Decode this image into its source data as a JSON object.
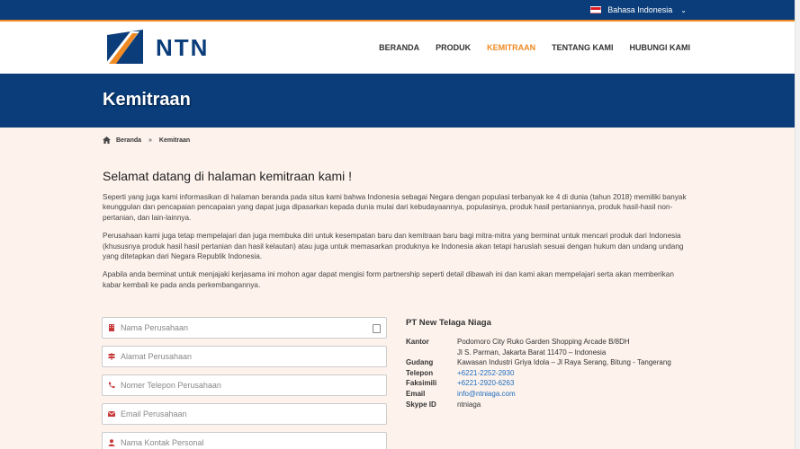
{
  "topbar": {
    "language": "Bahasa Indonesia",
    "flag_icon": "indonesia-flag-icon",
    "chevron_icon": "chevron-down-icon"
  },
  "header": {
    "logo_text": "NTN",
    "nav": [
      {
        "label": "BERANDA",
        "active": false
      },
      {
        "label": "PRODUK",
        "active": false
      },
      {
        "label": "KEMITRAAN",
        "active": true
      },
      {
        "label": "TENTANG KAMI",
        "active": false
      },
      {
        "label": "HUBUNGI KAMI",
        "active": false
      }
    ],
    "accent_color": "#f08a24",
    "brand_color": "#0a3d7a"
  },
  "banner": {
    "title": "Kemitraan"
  },
  "breadcrumb": {
    "home": "Beranda",
    "separator": "»",
    "current": "Kemitraan"
  },
  "main": {
    "heading": "Selamat datang di halaman kemitraan kami !",
    "paragraphs": [
      "Seperti yang juga kami informasikan di halaman beranda pada situs kami bahwa Indonesia sebagai Negara dengan populasi terbanyak ke 4 di dunia (tahun 2018) memiliki banyak keunggulan dan pencapaian pencapaian yang dapat juga dipasarkan kepada dunia mulai dari kebudayaannya, populasinya, produk hasil pertaniannya, produk hasil-hasil non-pertanian, dan lain-lainnya.",
      "Perusahaan kami juga tetap mempelajari dan juga membuka diri untuk kesempatan baru dan kemitraan baru bagi mitra-mitra yang berminat untuk mencari produk dari Indonesia (khususnya produk hasil hasil pertanian dan hasil kelautan) atau juga untuk memasarkan produknya ke Indonesia akan tetapi haruslah sesuai dengan hukum dan undang undang yang ditetapkan dari Negara Republik Indonesia.",
      "Apabila anda berminat untuk menjajaki kerjasama ini mohon agar dapat mengisi form partnership seperti detail dibawah ini dan kami akan mempelajari serta akan memberikan kabar kembali ke pada anda perkembangannya."
    ]
  },
  "form": {
    "fields": [
      {
        "placeholder": "Nama Perusahaan",
        "icon": "building-icon"
      },
      {
        "placeholder": "Alamat Perusahaan",
        "icon": "signpost-icon"
      },
      {
        "placeholder": "Nomer Telepon Perusahaan",
        "icon": "phone-icon"
      },
      {
        "placeholder": "Email Perusahaan",
        "icon": "envelope-icon"
      },
      {
        "placeholder": "Nama Kontak Personal",
        "icon": "user-icon"
      }
    ]
  },
  "contact": {
    "company": "PT New Telaga Niaga",
    "kantor_label": "Kantor",
    "kantor_line1": "Podomoro City Ruko Garden Shopping Arcade B/8DH",
    "kantor_line2": "Jl S. Parman, Jakarta Barat 11470 – Indonesia",
    "gudang_label": "Gudang",
    "gudang": "Kawasan Industri Griya Idola – Jl Raya Serang, Bitung - Tangerang",
    "telepon_label": "Telepon",
    "telepon": "+6221-2252-2930",
    "faksimili_label": "Faksimili",
    "faksimili": "+6221-2920-6263",
    "email_label": "Email",
    "email": "info@ntniaga.com",
    "skype_label": "Skype ID",
    "skype": "ntniaga"
  }
}
